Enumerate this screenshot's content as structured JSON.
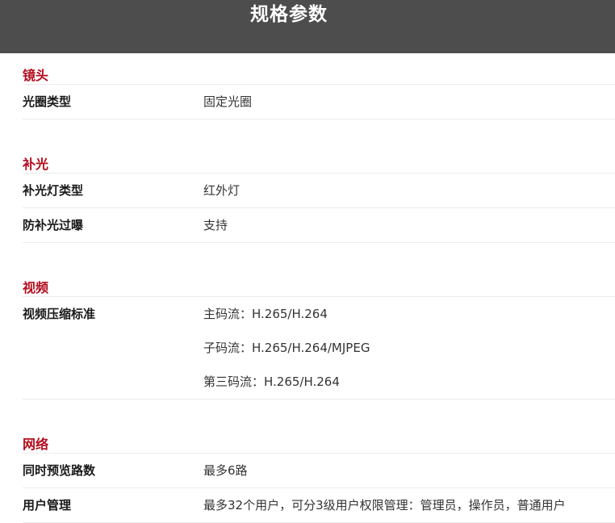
{
  "header": {
    "title": "规格参数"
  },
  "sections": [
    {
      "title": "镜头",
      "rows": [
        {
          "label": "光圈类型",
          "values": [
            "固定光圈"
          ]
        }
      ]
    },
    {
      "title": "补光",
      "rows": [
        {
          "label": "补光灯类型",
          "values": [
            "红外灯"
          ]
        },
        {
          "label": "防补光过曝",
          "values": [
            "支持"
          ]
        }
      ]
    },
    {
      "title": "视频",
      "rows": [
        {
          "label": "视频压缩标准",
          "values": [
            "主码流：H.265/H.264",
            "子码流：H.265/H.264/MJPEG",
            "第三码流：H.265/H.264"
          ]
        }
      ]
    },
    {
      "title": "网络",
      "rows": [
        {
          "label": "同时预览路数",
          "values": [
            "最多6路"
          ]
        },
        {
          "label": "用户管理",
          "values": [
            "最多32个用户，可分3级用户权限管理：管理员，操作员，普通用户"
          ]
        }
      ]
    }
  ],
  "colors": {
    "header_bg": "#4d4d4d",
    "section_title": "#b30d1e",
    "divider": "#ececec"
  }
}
